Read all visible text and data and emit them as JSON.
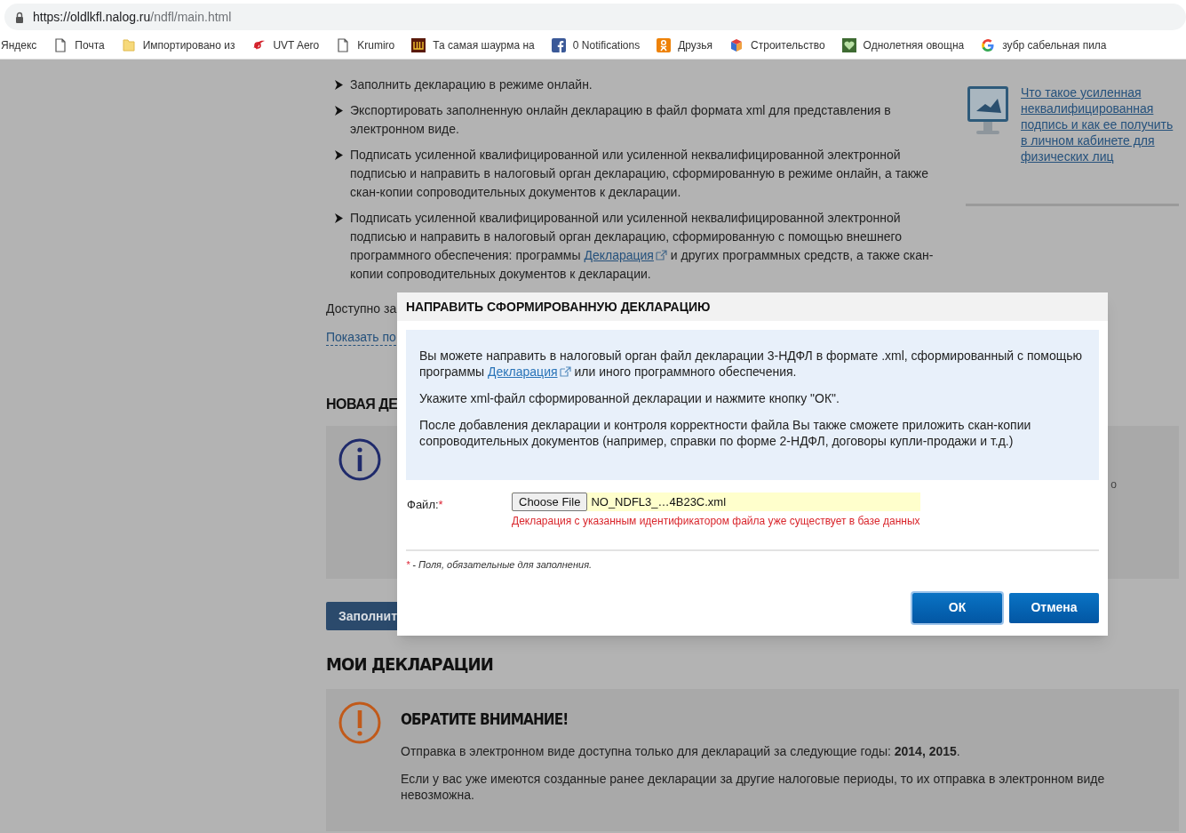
{
  "address_bar": {
    "host": "https://oldlkfl.nalog.ru",
    "path": "/ndfl/main.html"
  },
  "bookmarks": [
    {
      "label": "Яндекс",
      "kind": "none"
    },
    {
      "label": "Почта",
      "kind": "page"
    },
    {
      "label": "Импортировано из",
      "kind": "folder"
    },
    {
      "label": "UVT Aero",
      "kind": "swoosh"
    },
    {
      "label": "Krumiro",
      "kind": "page"
    },
    {
      "label": "Та самая шаурма на",
      "kind": "tile"
    },
    {
      "label": "0 Notifications",
      "kind": "facebook"
    },
    {
      "label": "Друзья",
      "kind": "ok"
    },
    {
      "label": "Строительство",
      "kind": "cube"
    },
    {
      "label": "Однолетняя овощна",
      "kind": "heart"
    },
    {
      "label": "зубр сабельная пила",
      "kind": "google"
    }
  ],
  "steps": [
    {
      "text": "Заполнить декларацию в режиме онлайн."
    },
    {
      "text": "Экспортировать заполненную онлайн декларацию в файл формата xml для представления в электронном виде."
    },
    {
      "text": "Подписать усиленной квалифицированной или усиленной неквалифицированной электронной подписью и направить в налоговый орган декларацию, сформированную в режиме онлайн, а также скан-копии сопроводительных документов к декларации."
    },
    {
      "before": "Подписать усиленной квалифицированной или усиленной неквалифицированной электронной подписью и направить в налоговый орган декларацию, сформированную с помощью внешнего программного обеспечения: программы ",
      "link": "Декларация",
      "after": " и других программных средств, а также скан-копии сопроводительных документов к декларации."
    }
  ],
  "sidebar": {
    "link": "Что такое усиленная неквалифицированная подпись и как ее получить в личном кабинете для физических лиц"
  },
  "available_text": "Доступно за",
  "show_link": "Показать по",
  "new_heading": "НОВАЯ ДЕ",
  "info_box": {
    "fragment": "о"
  },
  "fill_button": "Заполнит",
  "my_heading": "МОИ ДЕКЛАРАЦИИ",
  "notice": {
    "title": "ОБРАТИТЕ ВНИМАНИЕ!",
    "paragraphs": [
      "Отправка в электронном виде доступна только для деклараций за следующие годы: **2014, 2015**.",
      "Если у вас уже имеются созданные ранее декларации за другие налоговые периоды, то их отправка в электронном виде невозможна."
    ]
  },
  "modal": {
    "title": "НАПРАВИТЬ СФОРМИРОВАННУЮ ДЕКЛАРАЦИЮ",
    "intro": {
      "before": "Вы можете направить в налоговый орган файл декларации 3-НДФЛ в формате .xml, сформированный с помощью программы ",
      "link": "Декларация",
      "after": " или иного программного обеспечения."
    },
    "paragraphs": [
      "Укажите xml-файл сформированной декларации и нажмите кнопку \"ОК\".",
      "После добавления декларации и контроля корректности файла Вы также сможете приложить скан-копии сопроводительных документов (например, справки по форме 2-НДФЛ, договоры купли-продажи и т.д.)"
    ],
    "file": {
      "label": "Файл:",
      "required_mark": "*",
      "button": "Choose File",
      "filename": "NO_NDFL3_…4B23C.xml",
      "error": "Декларация с указанным идентификатором файла уже существует в базе данных"
    },
    "footnote": {
      "mark": "*",
      "text": " - Поля, обязательные для заполнения."
    },
    "buttons": [
      {
        "label": "ОК",
        "focused": true
      },
      {
        "label": "Отмена",
        "focused": false
      }
    ]
  }
}
